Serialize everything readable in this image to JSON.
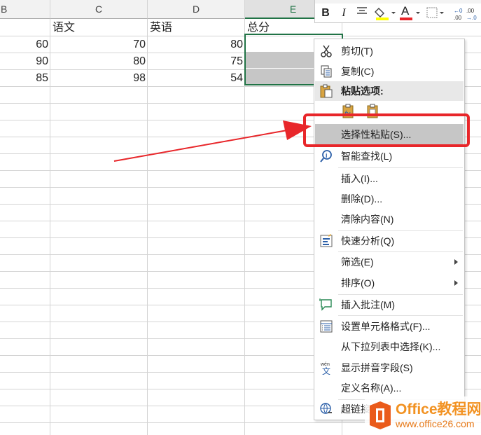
{
  "columns": [
    {
      "letter": "B",
      "selected": false
    },
    {
      "letter": "C",
      "selected": false
    },
    {
      "letter": "D",
      "selected": false
    },
    {
      "letter": "E",
      "selected": true
    }
  ],
  "table": {
    "headers": [
      "",
      "语文",
      "英语",
      "总分"
    ],
    "rows": [
      [
        "60",
        "70",
        "80",
        ""
      ],
      [
        "90",
        "80",
        "75",
        ""
      ],
      [
        "85",
        "98",
        "54",
        ""
      ]
    ]
  },
  "mini_toolbar": {
    "bold": "B",
    "italic": "I",
    "font_color_letter": "A",
    "font_color": "#e8262a",
    "fill_color": "#ffff00"
  },
  "context_menu": {
    "items": [
      {
        "label": "剪切(T)",
        "icon": "scissors-icon"
      },
      {
        "label": "复制(C)",
        "icon": "copy-icon"
      },
      {
        "label": "粘贴选项:",
        "icon": "clipboard-icon"
      },
      {
        "label": "",
        "icon": "paste-icons"
      },
      {
        "label": "选择性粘贴(S)...",
        "icon": ""
      },
      {
        "label": "智能查找(L)",
        "icon": "smart-lookup-icon"
      },
      {
        "label": "插入(I)...",
        "icon": ""
      },
      {
        "label": "删除(D)...",
        "icon": ""
      },
      {
        "label": "清除内容(N)",
        "icon": ""
      },
      {
        "label": "快速分析(Q)",
        "icon": "quick-analysis-icon"
      },
      {
        "label": "筛选(E)",
        "icon": "",
        "submenu": true
      },
      {
        "label": "排序(O)",
        "icon": "",
        "submenu": true
      },
      {
        "label": "插入批注(M)",
        "icon": "comment-icon"
      },
      {
        "label": "设置单元格格式(F)...",
        "icon": "format-cells-icon"
      },
      {
        "label": "从下拉列表中选择(K)...",
        "icon": ""
      },
      {
        "label": "显示拼音字段(S)",
        "icon": "phonetic-icon"
      },
      {
        "label": "定义名称(A)...",
        "icon": ""
      },
      {
        "label": "超链接",
        "icon": "hyperlink-icon"
      }
    ]
  },
  "colors": {
    "accent_green": "#217346",
    "highlight_red": "#e8262a",
    "selected_gray": "#c6c6c6"
  },
  "watermark": {
    "title": "Office教程网",
    "url": "www.office26.com"
  }
}
